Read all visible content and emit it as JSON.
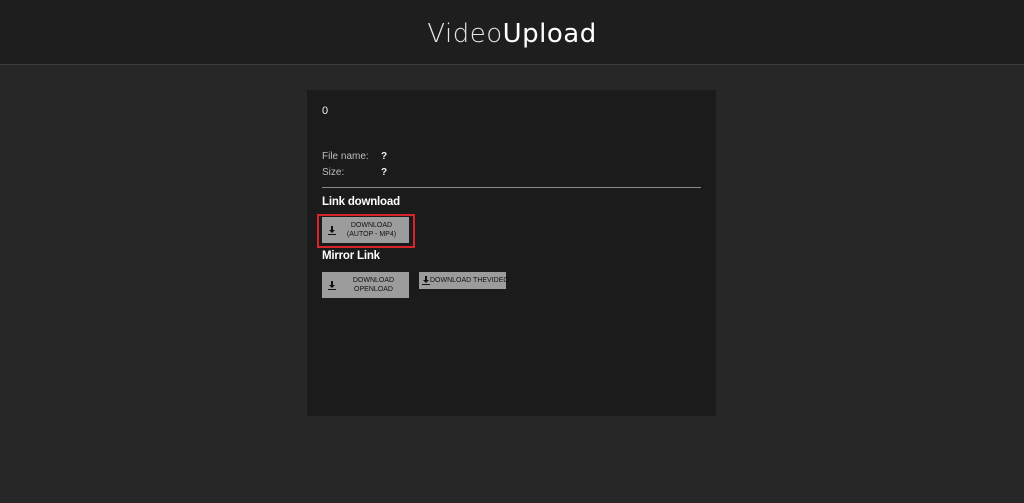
{
  "header": {
    "logo_light": "Video",
    "logo_bold": "Upload"
  },
  "panel": {
    "counter": "0",
    "file_name_label": "File name:",
    "file_name_value": "?",
    "size_label": "Size:",
    "size_value": "?",
    "link_download_title": "Link download",
    "download_autop_label": "DOWNLOAD (AUTOP - MP4)",
    "mirror_link_title": "Mirror Link",
    "download_openload_label": "DOWNLOAD OPENLOAD",
    "download_thevideo_label": "DOWNLOAD THEVIDEO"
  },
  "icons": {
    "download": "download-icon"
  },
  "colors": {
    "page_bg": "#272727",
    "header_bg": "#1e1e1e",
    "panel_bg": "#1b1b1b",
    "button_bg": "#9c9c9c",
    "highlight": "#d9232a"
  }
}
